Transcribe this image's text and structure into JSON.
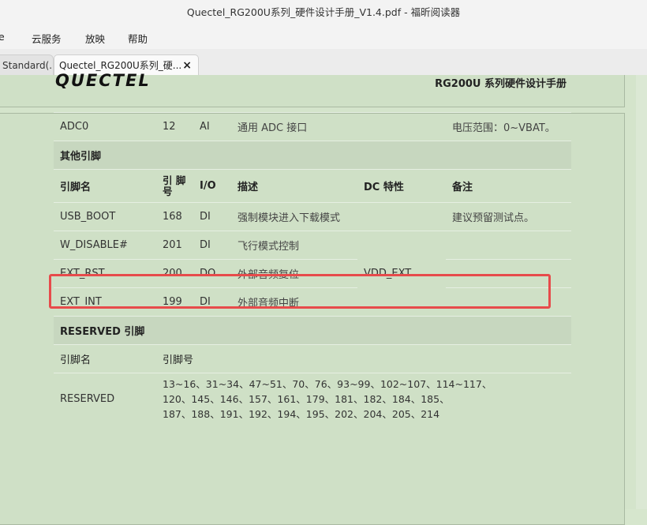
{
  "window": {
    "title": "Quectel_RG200U系列_硬件设计手册_V1.4.pdf - 福昕阅读器"
  },
  "menu": {
    "items": [
      "e",
      "云服务",
      "放映",
      "帮助"
    ]
  },
  "tabs": [
    {
      "label": "Standard(...",
      "active": false
    },
    {
      "label": "Quectel_RG200U系列_硬...",
      "active": true,
      "close": "×"
    }
  ],
  "document": {
    "logo_text": "QUECTEL",
    "header_title": "RG200U 系列硬件设计手册",
    "rows": {
      "adc0": {
        "name": "ADC0",
        "pin": "12",
        "io": "AI",
        "desc": "通用 ADC 接口",
        "note": "电压范围：0~VBAT。"
      },
      "other_section": "其他引脚",
      "header": {
        "name": "引脚名",
        "pin": "引 脚号",
        "io": "I/O",
        "desc": "描述",
        "dc": "DC 特性",
        "note": "备注"
      },
      "usb_boot": {
        "name": "USB_BOOT",
        "pin": "168",
        "io": "DI",
        "desc": "强制模块进入下载模式",
        "note": "建议预留测试点。"
      },
      "w_disable": {
        "name": "W_DISABLE#",
        "pin": "201",
        "io": "DI",
        "desc": "飞行模式控制"
      },
      "dc_vdd": "VDD_EXT",
      "ext_rst": {
        "name": "EXT_RST",
        "pin": "200",
        "io": "DO",
        "desc": "外部音频复位"
      },
      "ext_int": {
        "name": "EXT_INT",
        "pin": "199",
        "io": "DI",
        "desc": "外部音频中断"
      },
      "reserved_section": "RESERVED 引脚",
      "reserved_header": {
        "name": "引脚名",
        "pin": "引脚号"
      },
      "reserved": {
        "name": "RESERVED",
        "pins_line1": "13~16、31~34、47~51、70、76、93~99、102~107、114~117、",
        "pins_line2": "120、145、146、157、161、179、181、182、184、185、",
        "pins_line3": "187、188、191、192、194、195、202、204、205、214"
      }
    }
  }
}
